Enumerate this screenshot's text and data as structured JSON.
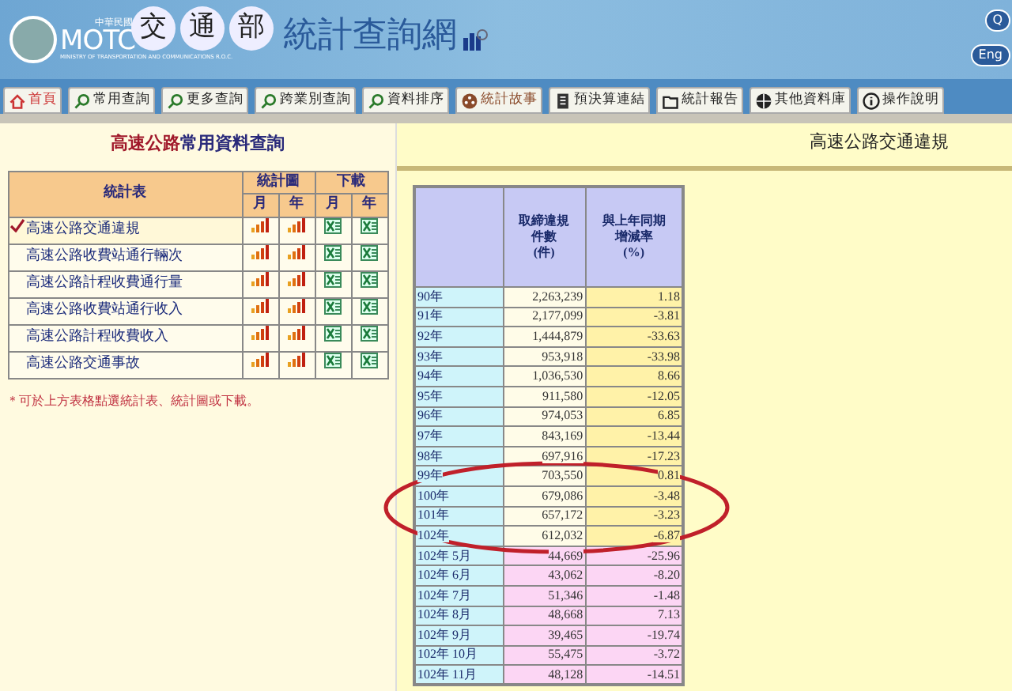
{
  "header": {
    "roc": "中華民國",
    "motc": "MOTC",
    "ministry": "MINISTRY OF TRANSPORTATION AND COMMUNICATIONS R.O.C.",
    "seals": [
      "交",
      "通",
      "部"
    ],
    "site_title": "統計查詢網",
    "edge_buttons": [
      "Q",
      "Eng"
    ]
  },
  "nav": [
    {
      "label": "首頁",
      "kind": "home"
    },
    {
      "label": "常用查詢",
      "kind": "search"
    },
    {
      "label": "更多查詢",
      "kind": "search"
    },
    {
      "label": "跨業別查詢",
      "kind": "search"
    },
    {
      "label": "資料排序",
      "kind": "search"
    },
    {
      "label": "統計故事",
      "kind": "story"
    },
    {
      "label": "預決算連結",
      "kind": "doc"
    },
    {
      "label": "統計報告",
      "kind": "folder"
    },
    {
      "label": "其他資料庫",
      "kind": "globe"
    },
    {
      "label": "操作說明",
      "kind": "info"
    }
  ],
  "left": {
    "title_highlight": "高速公路",
    "title_rest": "常用資料查詢",
    "col_table": "統計表",
    "col_chart": "統計圖",
    "col_download": "下載",
    "sub_cols": [
      "月",
      "年",
      "月",
      "年"
    ],
    "rows": [
      {
        "label": "高速公路交通違規",
        "selected": true
      },
      {
        "label": "高速公路收費站通行輛次",
        "selected": false
      },
      {
        "label": "高速公路計程收費通行量",
        "selected": false
      },
      {
        "label": "高速公路收費站通行收入",
        "selected": false
      },
      {
        "label": "高速公路計程收費收入",
        "selected": false
      },
      {
        "label": "高速公路交通事故",
        "selected": false
      }
    ],
    "note": "＊可於上方表格點選統計表、統計圖或下載。"
  },
  "right": {
    "title": "高速公路交通違規",
    "columns": [
      [
        "取締違規",
        "件數",
        "(件)"
      ],
      [
        "與上年同期",
        "增減率",
        "(%)"
      ]
    ],
    "rows": [
      {
        "period": "90年",
        "count": "2,263,239",
        "rate": "1.18",
        "kind": "year"
      },
      {
        "period": "91年",
        "count": "2,177,099",
        "rate": "-3.81",
        "kind": "year"
      },
      {
        "period": "92年",
        "count": "1,444,879",
        "rate": "-33.63",
        "kind": "year"
      },
      {
        "period": "93年",
        "count": "953,918",
        "rate": "-33.98",
        "kind": "year"
      },
      {
        "period": "94年",
        "count": "1,036,530",
        "rate": "8.66",
        "kind": "year"
      },
      {
        "period": "95年",
        "count": "911,580",
        "rate": "-12.05",
        "kind": "year"
      },
      {
        "period": "96年",
        "count": "974,053",
        "rate": "6.85",
        "kind": "year"
      },
      {
        "period": "97年",
        "count": "843,169",
        "rate": "-13.44",
        "kind": "year"
      },
      {
        "period": "98年",
        "count": "697,916",
        "rate": "-17.23",
        "kind": "year"
      },
      {
        "period": "99年",
        "count": "703,550",
        "rate": "0.81",
        "kind": "year"
      },
      {
        "period": "100年",
        "count": "679,086",
        "rate": "-3.48",
        "kind": "year"
      },
      {
        "period": "101年",
        "count": "657,172",
        "rate": "-3.23",
        "kind": "year"
      },
      {
        "period": "102年",
        "count": "612,032",
        "rate": "-6.87",
        "kind": "year"
      },
      {
        "period": "102年 5月",
        "count": "44,669",
        "rate": "-25.96",
        "kind": "month"
      },
      {
        "period": "102年 6月",
        "count": "43,062",
        "rate": "-8.20",
        "kind": "month"
      },
      {
        "period": "102年 7月",
        "count": "51,346",
        "rate": "-1.48",
        "kind": "month"
      },
      {
        "period": "102年 8月",
        "count": "48,668",
        "rate": "7.13",
        "kind": "month"
      },
      {
        "period": "102年 9月",
        "count": "39,465",
        "rate": "-19.74",
        "kind": "month"
      },
      {
        "period": "102年 10月",
        "count": "55,475",
        "rate": "-3.72",
        "kind": "month"
      },
      {
        "period": "102年 11月",
        "count": "48,128",
        "rate": "-14.51",
        "kind": "month"
      }
    ]
  }
}
